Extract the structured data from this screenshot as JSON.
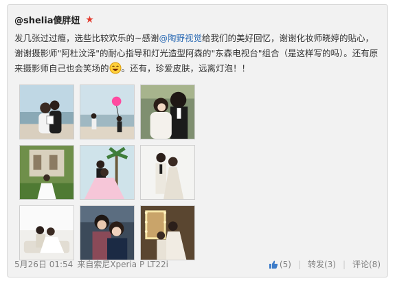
{
  "author": {
    "name": "@shelia傻胖妞",
    "badge_icon": "star-badge-icon",
    "badge_color": "#e3382b"
  },
  "post": {
    "text_before_mention": "发几张过过瘾，选些比较欢乐的~感谢",
    "mention": "@陶野视觉",
    "text_after_mention": "给我们的美好回忆，谢谢化妆师晓婷的贴心，谢谢摄影师\"阿杜汶泽\"的耐心指导和灯光造型阿森的\"东森电视台\"组合（是这样写的吗）。还有原来摄影师自己也会笑场的",
    "emoji": "laughing-face-emoji",
    "text_end": "。还有，珍爱皮肤，远离灯泡！！",
    "mention_color": "#2f6db5"
  },
  "photos": [
    {
      "name": "photo-1",
      "desc": "beach couple phone"
    },
    {
      "name": "photo-2",
      "desc": "beach balloon"
    },
    {
      "name": "photo-3",
      "desc": "couple close-up"
    },
    {
      "name": "photo-4",
      "desc": "garden villa bride"
    },
    {
      "name": "photo-5",
      "desc": "pink gown palm trees"
    },
    {
      "name": "photo-6",
      "desc": "white studio couple"
    },
    {
      "name": "photo-7",
      "desc": "white room sofa"
    },
    {
      "name": "photo-8",
      "desc": "suit close-up"
    },
    {
      "name": "photo-9",
      "desc": "vanity mirror lights"
    }
  ],
  "footer": {
    "timestamp": "5月26日 01:54",
    "source": "来自索尼Xperia P LT22i",
    "likes": "(5)",
    "repost": "转发(3)",
    "comment": "评论(8)",
    "separator": "|"
  }
}
